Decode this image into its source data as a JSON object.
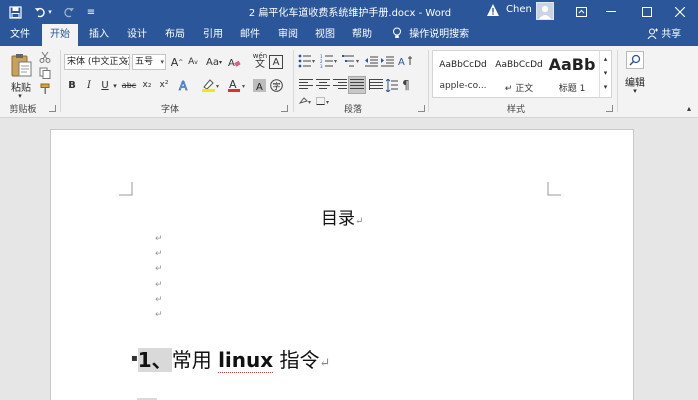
{
  "window": {
    "title": "2 扁平化车道收费系统维护手册.docx - Word",
    "user": "Chen"
  },
  "tabs": [
    {
      "label": "文件"
    },
    {
      "label": "开始"
    },
    {
      "label": "插入"
    },
    {
      "label": "设计"
    },
    {
      "label": "布局"
    },
    {
      "label": "引用"
    },
    {
      "label": "邮件"
    },
    {
      "label": "审阅"
    },
    {
      "label": "视图"
    },
    {
      "label": "帮助"
    }
  ],
  "search_label": "操作说明搜索",
  "share_label": "共享",
  "ribbon": {
    "clipboard": {
      "label": "剪贴板",
      "paste_label": "粘贴"
    },
    "font": {
      "label": "字体",
      "font_name": "宋体 (中文正文)",
      "font_size": "五号",
      "bold": "B",
      "italic": "I",
      "underline": "U",
      "strike": "abc",
      "sub": "x₂",
      "sup": "x²",
      "grow": "A",
      "wen": "wén",
      "case": "Aa"
    },
    "paragraph": {
      "label": "段落"
    },
    "styles": {
      "label": "样式",
      "items": [
        {
          "preview": "AaBbCcDd",
          "name": "apple-co..."
        },
        {
          "preview": "AaBbCcDd",
          "name": "↵ 正文"
        },
        {
          "preview": "AaBb",
          "name": "标题 1"
        }
      ]
    },
    "editing": {
      "label": "编辑"
    }
  },
  "document": {
    "toc_title": "目录",
    "para_mark": "↵",
    "heading_number": "1、",
    "heading_text_a": "常用 ",
    "heading_text_bold": "linux",
    "heading_text_b": " 指令"
  }
}
